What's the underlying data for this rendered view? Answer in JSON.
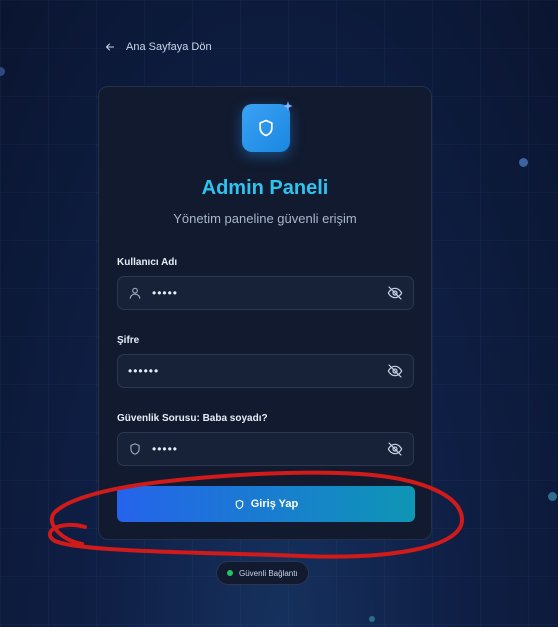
{
  "back_link": {
    "label": "Ana Sayfaya Dön",
    "icon": "arrow-left-icon"
  },
  "header": {
    "title": "Admin Paneli",
    "subtitle": "Yönetim paneline güvenli erişim",
    "logo_icon": "shield-icon"
  },
  "form": {
    "username": {
      "label": "Kullanıcı Adı",
      "value": "•••••",
      "icon": "user-icon",
      "toggle_icon": "eye-off-icon"
    },
    "password": {
      "label": "Şifre",
      "value": "••••••",
      "toggle_icon": "eye-off-icon"
    },
    "security": {
      "label": "Güvenlik Sorusu: Baba soyadı?",
      "value": "•••••",
      "icon": "shield-icon",
      "toggle_icon": "eye-off-icon"
    },
    "submit_label": "Giriş Yap"
  },
  "status_badge": {
    "label": "Güvenli Bağlantı",
    "color": "#22c55e"
  },
  "colors": {
    "accent": "#2ec4f0",
    "button_start": "#2563eb",
    "button_end": "#0e96b5",
    "annotation": "#d11a1a"
  }
}
